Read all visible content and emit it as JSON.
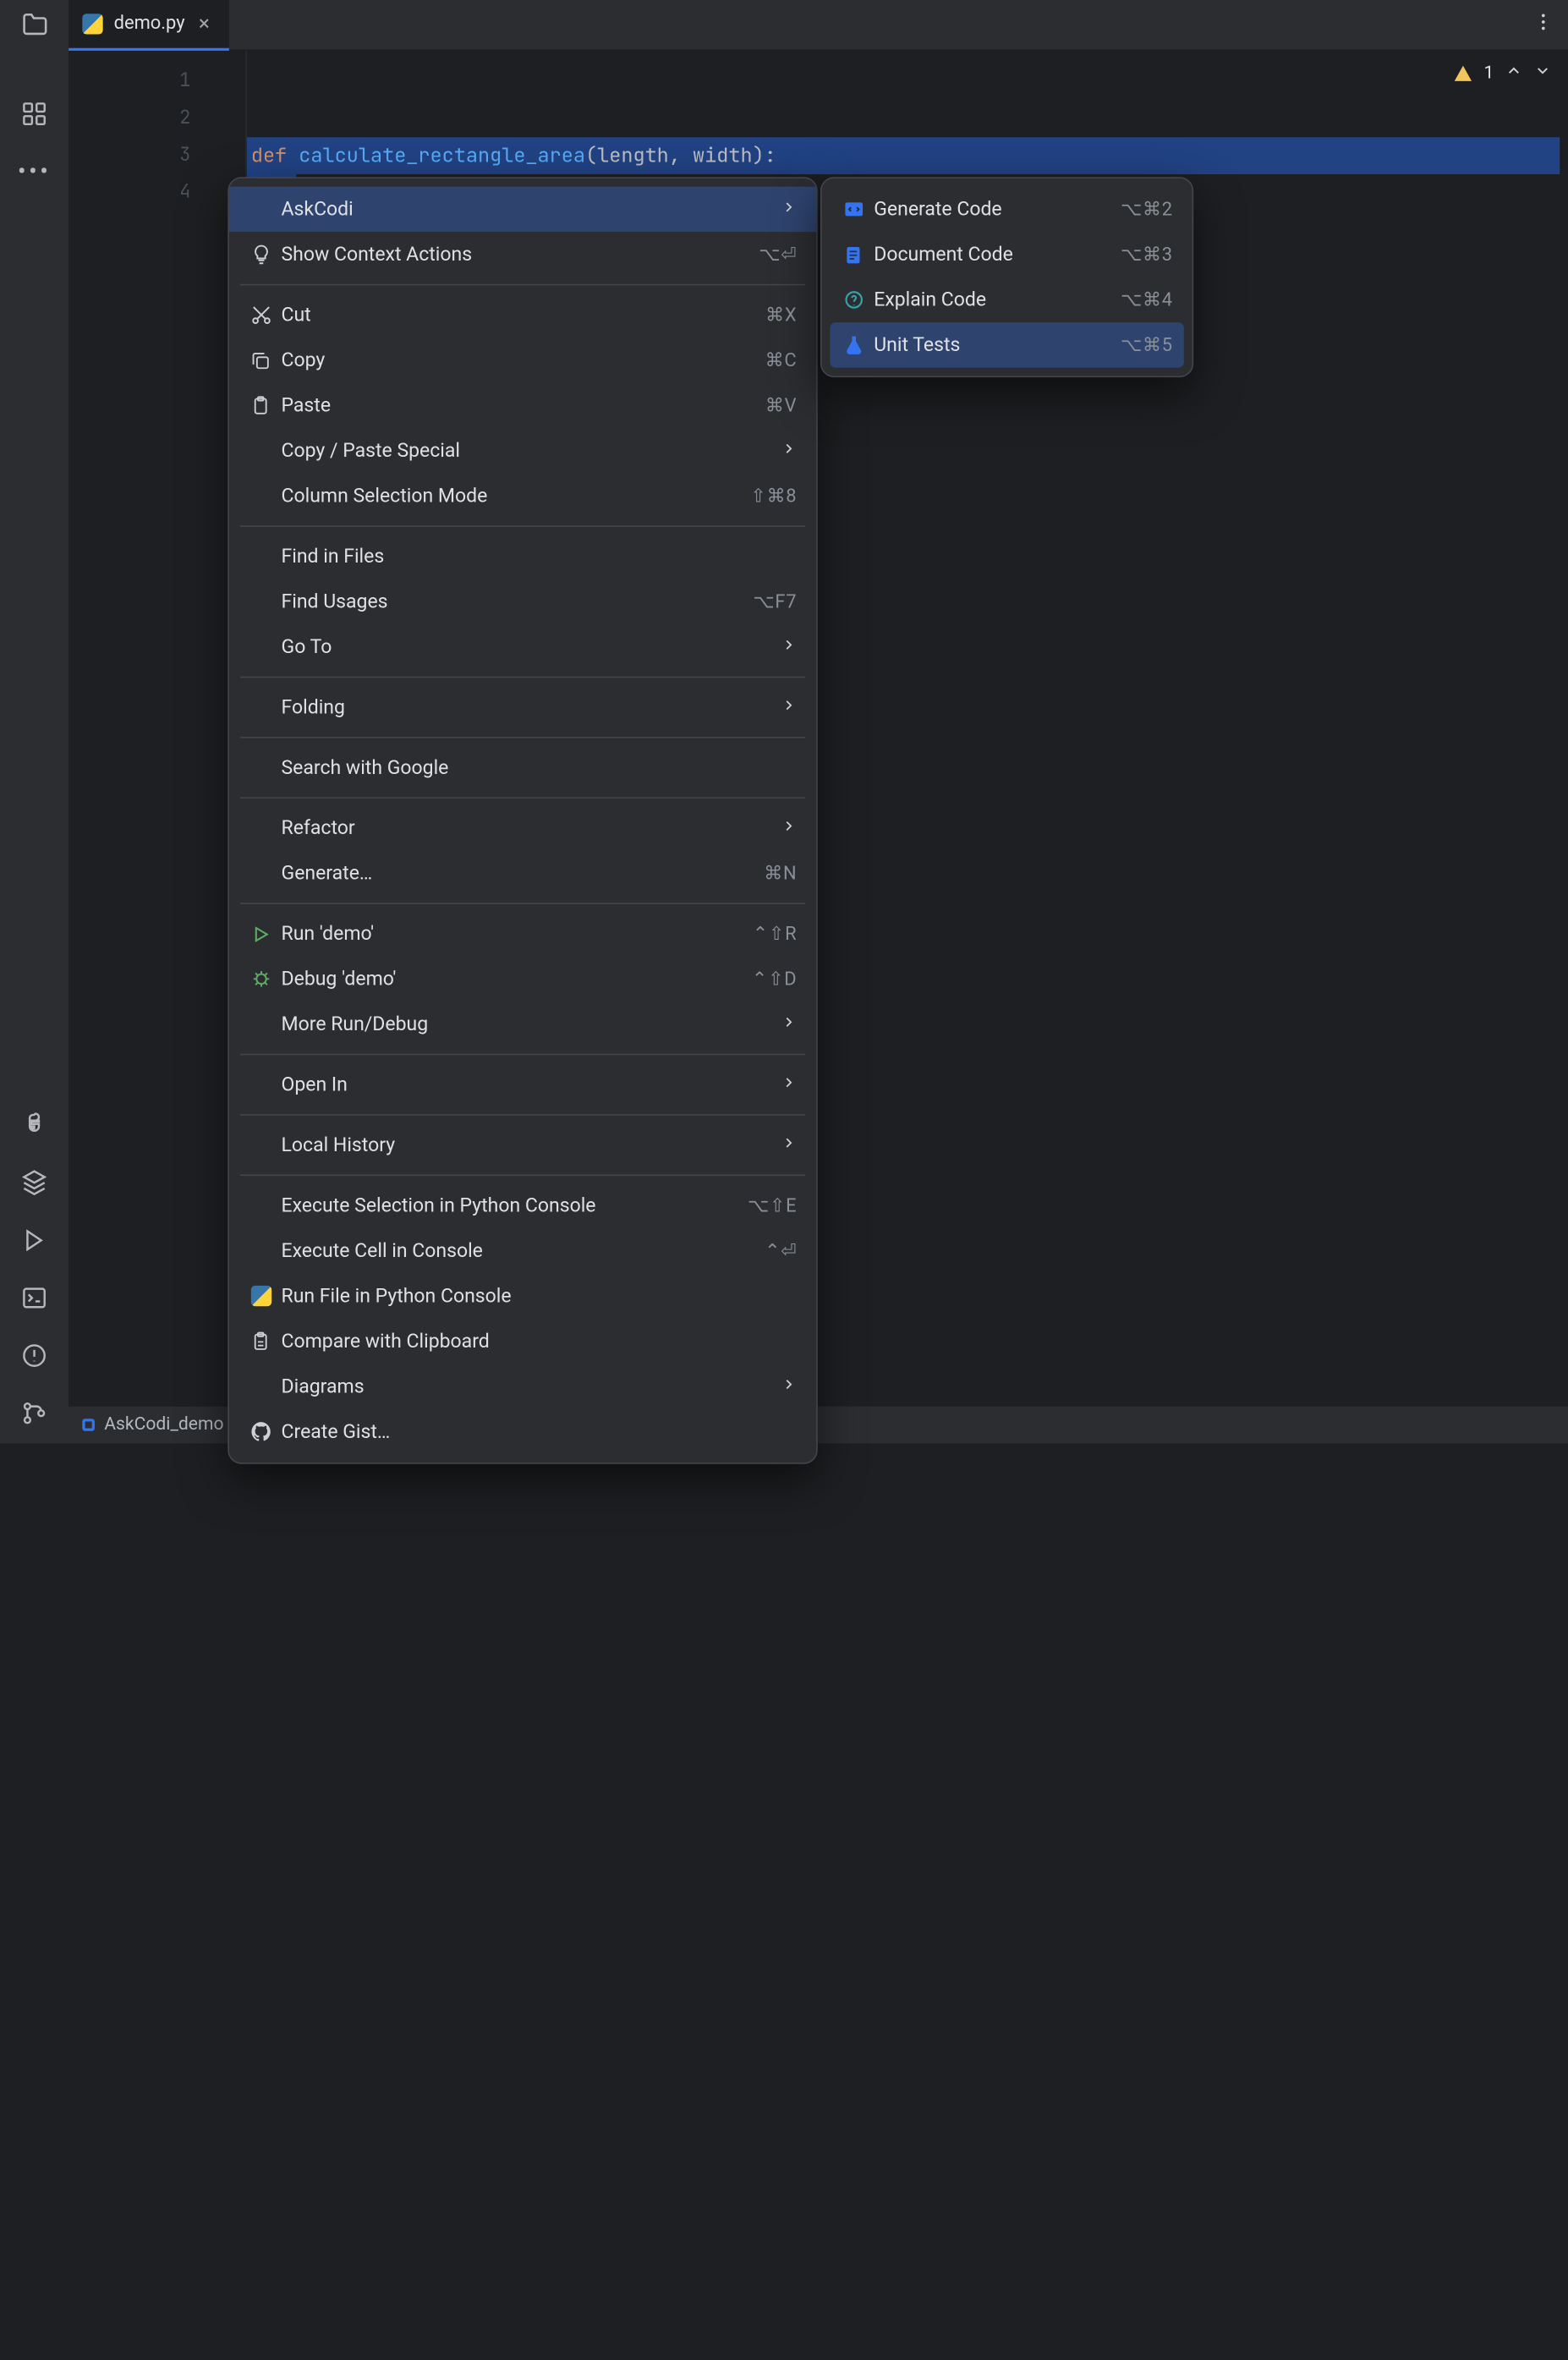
{
  "tab": {
    "title": "demo.py"
  },
  "editor": {
    "lineNumbers": [
      "1",
      "2",
      "3",
      "4"
    ],
    "code": {
      "kw": "def ",
      "fn": "calculate_rectangle_area",
      "rest": "(length, width):"
    },
    "warningCount": "1"
  },
  "statusbar": {
    "project": "AskCodi_demo"
  },
  "contextMenu": [
    {
      "icon": "",
      "label": "AskCodi",
      "shortcut": "",
      "chev": true,
      "hl": true
    },
    {
      "icon": "bulb",
      "label": "Show Context Actions",
      "shortcut": "⌥⏎"
    },
    {
      "sep": true
    },
    {
      "icon": "cut",
      "label": "Cut",
      "shortcut": "⌘X"
    },
    {
      "icon": "copy",
      "label": "Copy",
      "shortcut": "⌘C"
    },
    {
      "icon": "paste",
      "label": "Paste",
      "shortcut": "⌘V"
    },
    {
      "icon": "",
      "label": "Copy / Paste Special",
      "chev": true
    },
    {
      "icon": "",
      "label": "Column Selection Mode",
      "shortcut": "⇧⌘8"
    },
    {
      "sep": true
    },
    {
      "icon": "",
      "label": "Find in Files"
    },
    {
      "icon": "",
      "label": "Find Usages",
      "shortcut": "⌥F7"
    },
    {
      "icon": "",
      "label": "Go To",
      "chev": true
    },
    {
      "sep": true
    },
    {
      "icon": "",
      "label": "Folding",
      "chev": true
    },
    {
      "sep": true
    },
    {
      "icon": "",
      "label": "Search with Google"
    },
    {
      "sep": true
    },
    {
      "icon": "",
      "label": "Refactor",
      "chev": true
    },
    {
      "icon": "",
      "label": "Generate…",
      "shortcut": "⌘N"
    },
    {
      "sep": true
    },
    {
      "icon": "run",
      "label": "Run 'demo'",
      "shortcut": "⌃⇧R"
    },
    {
      "icon": "bug",
      "label": "Debug 'demo'",
      "shortcut": "⌃⇧D"
    },
    {
      "icon": "",
      "label": "More Run/Debug",
      "chev": true
    },
    {
      "sep": true
    },
    {
      "icon": "",
      "label": "Open In",
      "chev": true
    },
    {
      "sep": true
    },
    {
      "icon": "",
      "label": "Local History",
      "chev": true
    },
    {
      "sep": true
    },
    {
      "icon": "",
      "label": "Execute Selection in Python Console",
      "shortcut": "⌥⇧E"
    },
    {
      "icon": "",
      "label": "Execute Cell in Console",
      "shortcut": "⌃⏎"
    },
    {
      "icon": "py",
      "label": "Run File in Python Console"
    },
    {
      "icon": "clip",
      "label": "Compare with Clipboard"
    },
    {
      "icon": "",
      "label": "Diagrams",
      "chev": true
    },
    {
      "icon": "gh",
      "label": "Create Gist…"
    }
  ],
  "submenu": [
    {
      "icon": "code",
      "label": "Generate Code",
      "shortcut": "⌥⌘2",
      "color": "#3574f0"
    },
    {
      "icon": "doc",
      "label": "Document Code",
      "shortcut": "⌥⌘3",
      "color": "#3574f0"
    },
    {
      "icon": "explain",
      "label": "Explain Code",
      "shortcut": "⌥⌘4",
      "color": "#37a0a8"
    },
    {
      "icon": "test",
      "label": "Unit Tests",
      "shortcut": "⌥⌘5",
      "color": "#3574f0",
      "hl": true
    }
  ]
}
